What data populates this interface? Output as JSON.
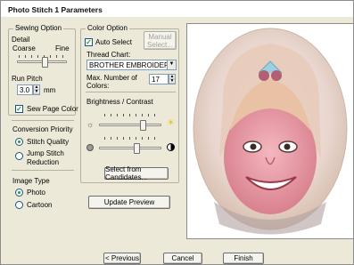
{
  "window": {
    "title": "Photo Stitch 1 Parameters"
  },
  "sewing_option": {
    "title": "Sewing Option",
    "detail_label": "Detail",
    "coarse_label": "Coarse",
    "fine_label": "Fine",
    "run_pitch_label": "Run Pitch",
    "run_pitch_value": "3.0",
    "run_pitch_unit": "mm",
    "sew_page_color_label": "Sew Page Color",
    "sew_page_color_checked": true
  },
  "conversion_priority": {
    "title": "Conversion Priority",
    "options": [
      "Stitch Quality",
      "Jump Stitch Reduction"
    ],
    "selected": "Stitch Quality"
  },
  "image_type": {
    "title": "Image Type",
    "options": [
      "Photo",
      "Cartoon"
    ],
    "selected": "Photo"
  },
  "color_option": {
    "title": "Color Option",
    "auto_select_label": "Auto Select",
    "auto_select_checked": true,
    "manual_select_label": "Manual Select...",
    "thread_chart_label": "Thread Chart:",
    "thread_chart_value": "BROTHER EMBROIDERY",
    "max_colors_label": "Max. Number of Colors:",
    "max_colors_value": "17",
    "brightness_contrast_label": "Brightness / Contrast",
    "select_candidates_label": "Select from Candidates..."
  },
  "sliders": {
    "detail_level": 0.55,
    "brightness_level": 0.7,
    "contrast_level": 0.6
  },
  "buttons": {
    "update_preview": "Update Preview",
    "previous": "< Previous",
    "cancel": "Cancel",
    "finish": "Finish"
  },
  "icons": {
    "brightness_low": "sun-small-icon",
    "brightness_high": "sun-bright-icon",
    "contrast_low": "circle-gray-icon",
    "contrast_high": "circle-half-icon"
  },
  "colors": {
    "dialog_bg": "#ece9d8",
    "check_mark": "#21a121",
    "sun_yellow": "#e8c21a"
  }
}
